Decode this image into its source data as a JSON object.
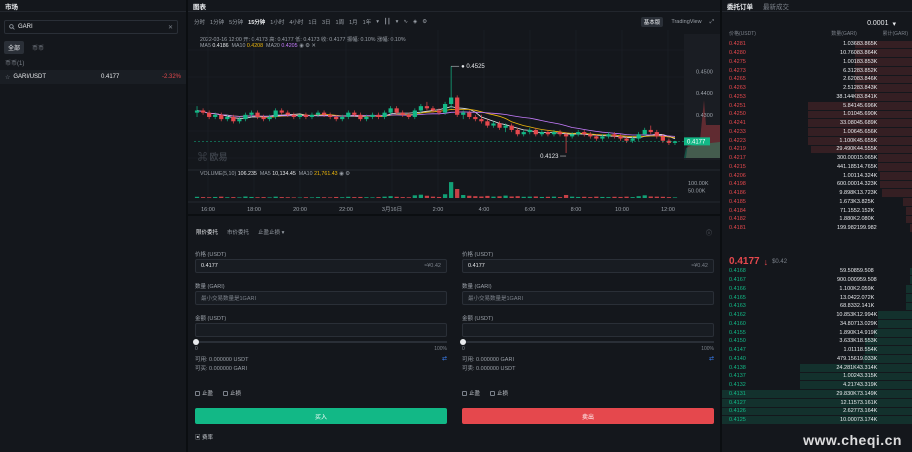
{
  "markets": {
    "title": "市场",
    "search_value": "GARI",
    "tabs": [
      "全部",
      "币币"
    ],
    "category": "币币(1)",
    "rows": [
      {
        "pair": "GARI/USDT",
        "price": "0.4177",
        "change": "-2.32%"
      }
    ]
  },
  "chart": {
    "title": "图表",
    "intervals": [
      "分时",
      "1分钟",
      "5分钟",
      "15分钟",
      "1小时",
      "4小时",
      "1日",
      "3日",
      "1周",
      "1月",
      "1年"
    ],
    "selected_interval": "15分钟",
    "views": [
      "基本版",
      "TradingView"
    ],
    "ohlc_line": "2022-03-16 12:00  开: 0.4173  高: 0.4177  低: 0.4173  收: 0.4177  振幅: 0.10%  涨幅: 0.10%",
    "ma": {
      "label": "MA5",
      "ma5": "0.4186",
      "ma10_label": "MA10",
      "ma10": "0.4208",
      "ma20_label": "MA20",
      "ma20": "0.4205"
    },
    "high_label": "0.4525",
    "low_label": "0.4123",
    "current_price": "0.4177",
    "y_ticks": [
      "0.4500",
      "0.4400",
      "0.4300"
    ],
    "time_ticks": [
      "16:00",
      "18:00",
      "20:00",
      "22:00",
      "3月16日",
      "2:00",
      "4:00",
      "6:00",
      "8:00",
      "10:00",
      "12:00"
    ],
    "volume": {
      "label": "VOLUME(5,10)",
      "value": "106.235",
      "ma5_label": "MA5",
      "ma5": "10,134.45",
      "ma10_label": "MA10",
      "ma10": "21,761.43",
      "ticks": [
        "100.00K",
        "50.00K"
      ]
    },
    "watermark": "欧易"
  },
  "trade": {
    "tabs": [
      "限价委托",
      "市价委托",
      "止盈止损"
    ],
    "buy": {
      "price_label": "价格 (USDT)",
      "price": "0.4177",
      "price_cny": "≈¥0.42",
      "qty_label": "数量 (GARI)",
      "qty_placeholder": "最小交易数量是1GARI",
      "amount_label": "金额 (USDT)",
      "slider_min": "0",
      "slider_max": "100%",
      "available": "可用: 0.000000 USDT",
      "can_buy": "可买: 0.000000 GARI",
      "options": [
        "止盈",
        "止损"
      ],
      "button": "买入"
    },
    "sell": {
      "price_label": "价格 (USDT)",
      "price": "0.4177",
      "price_cny": "≈¥0.42",
      "qty_label": "数量 (GARI)",
      "qty_placeholder": "最小交易数量是1GARI",
      "amount_label": "金额 (USDT)",
      "slider_min": "0",
      "slider_max": "100%",
      "available": "可用: 0.000000 GARI",
      "can_sell": "可卖: 0.000000 USDT",
      "options": [
        "止盈",
        "止损"
      ],
      "button": "卖出"
    },
    "fee": "费率"
  },
  "book": {
    "tabs": [
      "委托订单",
      "最新成交"
    ],
    "precision": "0.0001",
    "headers": [
      "价格(USDT)",
      "数量(GARI)",
      "累计(GARI)"
    ],
    "asks": [
      [
        "0.4281",
        "1.036",
        "83.865K"
      ],
      [
        "0.4280",
        "10.760",
        "83.864K"
      ],
      [
        "0.4275",
        "1.001",
        "83.853K"
      ],
      [
        "0.4273",
        "6.312",
        "83.852K"
      ],
      [
        "0.4265",
        "2.620",
        "83.846K"
      ],
      [
        "0.4263",
        "2.512",
        "83.843K"
      ],
      [
        "0.4253",
        "38.144K",
        "83.841K"
      ],
      [
        "0.4251",
        "5.841",
        "45.696K"
      ],
      [
        "0.4250",
        "1.010",
        "45.690K"
      ],
      [
        "0.4241",
        "33.080",
        "45.689K"
      ],
      [
        "0.4233",
        "1.006",
        "45.656K"
      ],
      [
        "0.4223",
        "1.100K",
        "45.655K"
      ],
      [
        "0.4219",
        "29.490K",
        "44.555K"
      ],
      [
        "0.4217",
        "300.000",
        "15.065K"
      ],
      [
        "0.4215",
        "441.185",
        "14.765K"
      ],
      [
        "0.4206",
        "1.001",
        "14.324K"
      ],
      [
        "0.4198",
        "600.000",
        "14.323K"
      ],
      [
        "0.4186",
        "9.898K",
        "13.723K"
      ],
      [
        "0.4185",
        "1.673K",
        "3.825K"
      ],
      [
        "0.4184",
        "71.155",
        "2.152K"
      ],
      [
        "0.4182",
        "1.880K",
        "2.080K"
      ],
      [
        "0.4181",
        "199.982",
        "199.982"
      ]
    ],
    "ask_fill": [
      0.3,
      0.3,
      0.3,
      0.3,
      0.3,
      0.3,
      0.3,
      0.55,
      0.55,
      0.55,
      0.55,
      0.55,
      0.53,
      0.18,
      0.18,
      0.17,
      0.17,
      0.16,
      0.05,
      0.03,
      0.03,
      0.01
    ],
    "last_price": "0.4177",
    "last_arrow": "↓",
    "last_cny": "$0.42",
    "bids": [
      [
        "0.4168",
        "59.508",
        "59.508"
      ],
      [
        "0.4167",
        "900.000",
        "959.508"
      ],
      [
        "0.4166",
        "1.100K",
        "2.059K"
      ],
      [
        "0.4165",
        "13.042",
        "2.072K"
      ],
      [
        "0.4163",
        "68.833",
        "2.141K"
      ],
      [
        "0.4162",
        "10.853K",
        "12.994K"
      ],
      [
        "0.4160",
        "34.807",
        "13.029K"
      ],
      [
        "0.4155",
        "1.890K",
        "14.919K"
      ],
      [
        "0.4150",
        "3.633K",
        "18.553K"
      ],
      [
        "0.4147",
        "1.011",
        "18.554K"
      ],
      [
        "0.4140",
        "479.156",
        "19.033K"
      ],
      [
        "0.4138",
        "24.281K",
        "43.314K"
      ],
      [
        "0.4137",
        "1.002",
        "43.315K"
      ],
      [
        "0.4132",
        "4.217",
        "43.319K"
      ],
      [
        "0.4131",
        "29.830K",
        "73.149K"
      ],
      [
        "0.4127",
        "12.115",
        "73.161K"
      ],
      [
        "0.4126",
        "2.627",
        "73.164K"
      ],
      [
        "0.4125",
        "10.000",
        "73.174K"
      ]
    ],
    "bid_fill": [
      0.01,
      0.01,
      0.03,
      0.03,
      0.03,
      0.18,
      0.18,
      0.2,
      0.25,
      0.25,
      0.26,
      0.59,
      0.59,
      0.59,
      1,
      1,
      1,
      1
    ]
  },
  "watermark": "www.cheqi.cn",
  "chart_data": {
    "type": "candlestick",
    "y_range": [
      0.41,
      0.46
    ],
    "volume_range": [
      0,
      120000
    ],
    "candles": [
      [
        0.431,
        0.434,
        0.429,
        0.432
      ],
      [
        0.432,
        0.433,
        0.43,
        0.431
      ],
      [
        0.431,
        0.432,
        0.428,
        0.429
      ],
      [
        0.429,
        0.431,
        0.428,
        0.43
      ],
      [
        0.43,
        0.431,
        0.427,
        0.428
      ],
      [
        0.428,
        0.43,
        0.427,
        0.429
      ],
      [
        0.429,
        0.43,
        0.426,
        0.427
      ],
      [
        0.427,
        0.429,
        0.426,
        0.428
      ],
      [
        0.428,
        0.431,
        0.427,
        0.43
      ],
      [
        0.43,
        0.432,
        0.429,
        0.431
      ],
      [
        0.431,
        0.432,
        0.428,
        0.429
      ],
      [
        0.429,
        0.43,
        0.427,
        0.428
      ],
      [
        0.428,
        0.43,
        0.427,
        0.429
      ],
      [
        0.429,
        0.433,
        0.428,
        0.432
      ],
      [
        0.432,
        0.433,
        0.43,
        0.431
      ],
      [
        0.431,
        0.432,
        0.429,
        0.43
      ],
      [
        0.43,
        0.431,
        0.428,
        0.429
      ],
      [
        0.429,
        0.43,
        0.428,
        0.43
      ],
      [
        0.43,
        0.431,
        0.428,
        0.429
      ],
      [
        0.429,
        0.431,
        0.428,
        0.43
      ],
      [
        0.43,
        0.432,
        0.429,
        0.431
      ],
      [
        0.431,
        0.432,
        0.429,
        0.43
      ],
      [
        0.43,
        0.431,
        0.428,
        0.429
      ],
      [
        0.429,
        0.43,
        0.427,
        0.428
      ],
      [
        0.428,
        0.43,
        0.427,
        0.429
      ],
      [
        0.429,
        0.432,
        0.428,
        0.431
      ],
      [
        0.431,
        0.432,
        0.429,
        0.43
      ],
      [
        0.43,
        0.431,
        0.427,
        0.428
      ],
      [
        0.428,
        0.43,
        0.427,
        0.429
      ],
      [
        0.429,
        0.431,
        0.428,
        0.43
      ],
      [
        0.43,
        0.431,
        0.428,
        0.429
      ],
      [
        0.429,
        0.432,
        0.428,
        0.431
      ],
      [
        0.431,
        0.434,
        0.43,
        0.433
      ],
      [
        0.433,
        0.434,
        0.43,
        0.431
      ],
      [
        0.431,
        0.432,
        0.429,
        0.43
      ],
      [
        0.43,
        0.431,
        0.428,
        0.429
      ],
      [
        0.429,
        0.433,
        0.428,
        0.432
      ],
      [
        0.432,
        0.435,
        0.431,
        0.434
      ],
      [
        0.434,
        0.436,
        0.432,
        0.433
      ],
      [
        0.433,
        0.434,
        0.431,
        0.432
      ],
      [
        0.432,
        0.433,
        0.43,
        0.431
      ],
      [
        0.431,
        0.436,
        0.43,
        0.435
      ],
      [
        0.435,
        0.4525,
        0.433,
        0.438
      ],
      [
        0.438,
        0.439,
        0.429,
        0.43
      ],
      [
        0.43,
        0.432,
        0.428,
        0.431
      ],
      [
        0.431,
        0.432,
        0.428,
        0.429
      ],
      [
        0.429,
        0.43,
        0.427,
        0.428
      ],
      [
        0.428,
        0.43,
        0.426,
        0.427
      ],
      [
        0.427,
        0.428,
        0.424,
        0.425
      ],
      [
        0.425,
        0.427,
        0.424,
        0.426
      ],
      [
        0.426,
        0.427,
        0.423,
        0.424
      ],
      [
        0.424,
        0.426,
        0.422,
        0.425
      ],
      [
        0.425,
        0.426,
        0.422,
        0.423
      ],
      [
        0.423,
        0.424,
        0.42,
        0.421
      ],
      [
        0.421,
        0.423,
        0.42,
        0.422
      ],
      [
        0.422,
        0.424,
        0.421,
        0.423
      ],
      [
        0.423,
        0.424,
        0.42,
        0.421
      ],
      [
        0.421,
        0.423,
        0.42,
        0.422
      ],
      [
        0.422,
        0.423,
        0.42,
        0.421
      ],
      [
        0.421,
        0.423,
        0.42,
        0.422
      ],
      [
        0.422,
        0.423,
        0.42,
        0.421
      ],
      [
        0.421,
        0.422,
        0.4123,
        0.42
      ],
      [
        0.42,
        0.422,
        0.419,
        0.421
      ],
      [
        0.421,
        0.423,
        0.42,
        0.422
      ],
      [
        0.422,
        0.423,
        0.42,
        0.421
      ],
      [
        0.421,
        0.422,
        0.419,
        0.42
      ],
      [
        0.42,
        0.421,
        0.418,
        0.419
      ],
      [
        0.419,
        0.421,
        0.418,
        0.42
      ],
      [
        0.42,
        0.422,
        0.419,
        0.421
      ],
      [
        0.421,
        0.422,
        0.419,
        0.42
      ],
      [
        0.42,
        0.421,
        0.418,
        0.419
      ],
      [
        0.419,
        0.42,
        0.417,
        0.418
      ],
      [
        0.418,
        0.42,
        0.417,
        0.419
      ],
      [
        0.419,
        0.422,
        0.418,
        0.421
      ],
      [
        0.421,
        0.424,
        0.42,
        0.423
      ],
      [
        0.423,
        0.425,
        0.421,
        0.422
      ],
      [
        0.422,
        0.423,
        0.419,
        0.42
      ],
      [
        0.42,
        0.421,
        0.417,
        0.418
      ],
      [
        0.418,
        0.419,
        0.416,
        0.417
      ],
      [
        0.417,
        0.418,
        0.416,
        0.4177
      ]
    ],
    "volumes": [
      8000,
      6000,
      5000,
      7000,
      9000,
      5000,
      6000,
      4000,
      10000,
      7000,
      5000,
      6000,
      4000,
      9000,
      6000,
      5000,
      4000,
      3000,
      5000,
      4000,
      6000,
      5000,
      4000,
      7000,
      5000,
      8000,
      6000,
      7000,
      5000,
      4000,
      6000,
      9000,
      12000,
      8000,
      6000,
      5000,
      18000,
      22000,
      15000,
      9000,
      7000,
      25000,
      106000,
      60000,
      20000,
      15000,
      12000,
      10000,
      14000,
      9000,
      11000,
      16000,
      10000,
      12000,
      8000,
      9000,
      10000,
      7000,
      8000,
      9000,
      6000,
      20000,
      9000,
      7000,
      8000,
      6000,
      9000,
      7000,
      6000,
      8000,
      7000,
      9000,
      6000,
      12000,
      18000,
      10000,
      9000,
      8000,
      6000,
      4000
    ]
  }
}
